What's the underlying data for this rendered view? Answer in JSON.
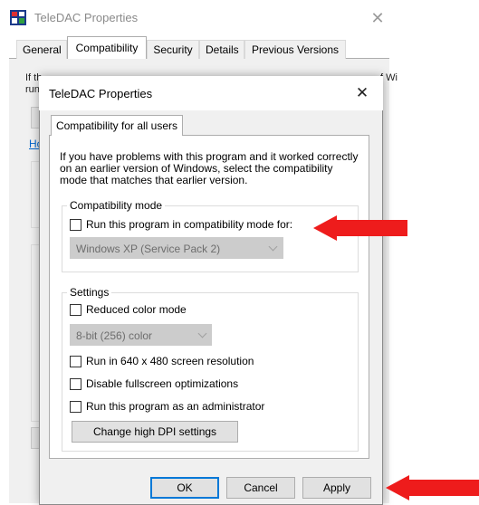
{
  "outer": {
    "title": "TeleDAC Properties",
    "close_glyph": "✕",
    "tabs": [
      "General",
      "Compatibility",
      "Security",
      "Details",
      "Previous Versions"
    ],
    "active_tab": "Compatibility",
    "peek_line1": "If th",
    "peek_line1_right": "f Wi",
    "peek_line2": "run",
    "peek_link": "Ho"
  },
  "inner": {
    "title": "TeleDAC Properties",
    "close_glyph": "✕",
    "tab_label": "Compatibility for all users",
    "description": "If you have problems with this program and it worked correctly on an earlier version of Windows, select the compatibility mode that matches that earlier version.",
    "compat_group": {
      "label": "Compatibility mode",
      "checkbox_label": "Run this program in compatibility mode for:",
      "select_value": "Windows XP (Service Pack 2)"
    },
    "settings_group": {
      "label": "Settings",
      "reduced_color_label": "Reduced color mode",
      "color_select_value": "8-bit (256) color",
      "res_label": "Run in 640 x 480 screen resolution",
      "fullscreen_label": "Disable fullscreen optimizations",
      "admin_label": "Run this program as an administrator",
      "dpi_button": "Change high DPI settings"
    },
    "buttons": {
      "ok": "OK",
      "cancel": "Cancel",
      "apply": "Apply"
    }
  },
  "colors": {
    "arrow": "#ee1c1c",
    "default_button_border": "#0078d7"
  }
}
